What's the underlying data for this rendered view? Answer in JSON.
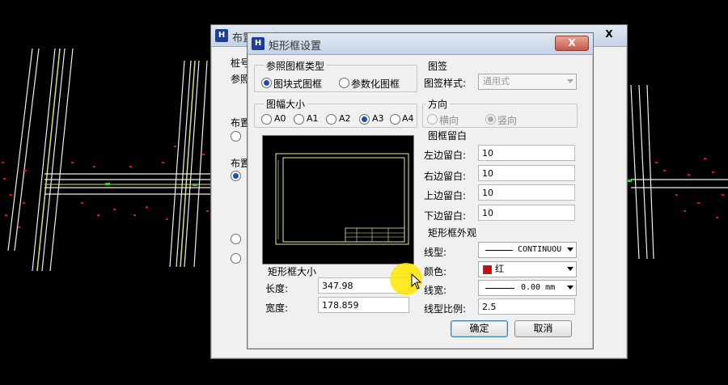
{
  "back_dialog": {
    "title": "布置矩形框",
    "partial_labels": [
      "桩号",
      "参照",
      "布置",
      "布置"
    ],
    "close": "X"
  },
  "dialog": {
    "title": "矩形框设置",
    "close": "X",
    "frame_type": {
      "title": "参照图框类型",
      "options": [
        "图块式图框",
        "参数化图框"
      ],
      "selected": "图块式图框"
    },
    "title_block": {
      "title": "图签",
      "style_label": "图签样式:",
      "style_value": "通用式"
    },
    "sheet_size": {
      "title": "图幅大小",
      "options": [
        "A0",
        "A1",
        "A2",
        "A3",
        "A4"
      ],
      "selected": "A3"
    },
    "orientation": {
      "title": "方向",
      "options": [
        "横向",
        "竖向"
      ],
      "selected": "竖向"
    },
    "margins": {
      "title": "图框留白",
      "left_label": "左边留白:",
      "left_value": "10",
      "right_label": "右边留白:",
      "right_value": "10",
      "top_label": "上边留白:",
      "top_value": "10",
      "bottom_label": "下边留白:",
      "bottom_value": "10"
    },
    "frame_size": {
      "title": "矩形框大小",
      "length_label": "长度:",
      "length_value": "347.98",
      "width_label": "宽度:",
      "width_value": "178.859"
    },
    "appearance": {
      "title": "矩形框外观",
      "linetype_label": "线型:",
      "linetype_value": "CONTINUOU",
      "color_label": "颜色:",
      "color_value": "红",
      "color_swatch": "#e00000",
      "lineweight_label": "线宽:",
      "lineweight_value": "0.00 mm",
      "ltscale_label": "线型比例:",
      "ltscale_value": "2.5"
    },
    "ok_label": "确定",
    "cancel_label": "取消"
  },
  "colors": {
    "cad_background": "#000000",
    "road_lines": "#f4f4f4",
    "centerline": "#e0e070",
    "markers": "#e01010",
    "cursor_highlight": "#ffe600"
  }
}
